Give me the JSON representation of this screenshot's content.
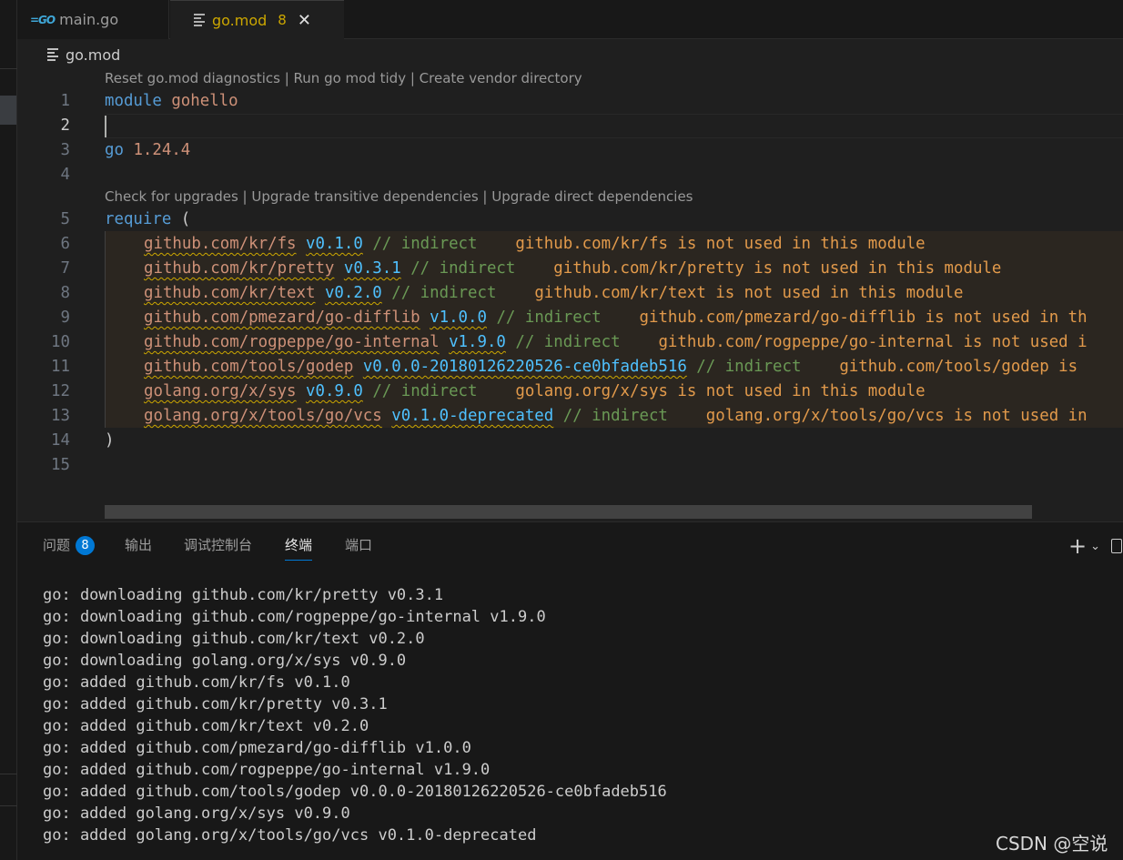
{
  "tabs": [
    {
      "file": "main.go",
      "icon": "go-file-icon"
    },
    {
      "file": "go.mod",
      "count": "8",
      "close": "✕",
      "icon": "lines-icon"
    }
  ],
  "breadcrumb": {
    "file": "go.mod"
  },
  "codelens": {
    "top": "Reset go.mod diagnostics | Run go mod tidy | Create vendor directory",
    "require": "Check for upgrades | Upgrade transitive dependencies | Upgrade direct dependencies"
  },
  "editor": {
    "line_numbers": [
      "1",
      "2",
      "3",
      "4",
      "5",
      "6",
      "7",
      "8",
      "9",
      "10",
      "11",
      "12",
      "13",
      "14",
      "15"
    ],
    "current_line": "2",
    "module_kw": "module",
    "module_name": "gohello",
    "go_kw": "go",
    "go_version": "1.24.4",
    "require_kw": "require",
    "open_paren": "(",
    "close_paren": ")",
    "requires": [
      {
        "path": "github.com/kr/fs",
        "version": "v0.1.0",
        "comment": "// indirect",
        "diag": "github.com/kr/fs is not used in this module"
      },
      {
        "path": "github.com/kr/pretty",
        "version": "v0.3.1",
        "comment": "// indirect",
        "diag": "github.com/kr/pretty is not used in this module"
      },
      {
        "path": "github.com/kr/text",
        "version": "v0.2.0",
        "comment": "// indirect",
        "diag": "github.com/kr/text is not used in this module"
      },
      {
        "path": "github.com/pmezard/go-difflib",
        "version": "v1.0.0",
        "comment": "// indirect",
        "diag": "github.com/pmezard/go-difflib is not used in th"
      },
      {
        "path": "github.com/rogpeppe/go-internal",
        "version": "v1.9.0",
        "comment": "// indirect",
        "diag": "github.com/rogpeppe/go-internal is not used i"
      },
      {
        "path": "github.com/tools/godep",
        "version": "v0.0.0-20180126220526-ce0bfadeb516",
        "comment": "// indirect",
        "diag": "github.com/tools/godep is"
      },
      {
        "path": "golang.org/x/sys",
        "version": "v0.9.0",
        "comment": "// indirect",
        "diag": "golang.org/x/sys is not used in this module"
      },
      {
        "path": "golang.org/x/tools/go/vcs",
        "version": "v0.1.0-deprecated",
        "comment": "// indirect",
        "diag": "golang.org/x/tools/go/vcs is not used in"
      }
    ]
  },
  "panel": {
    "tabs": [
      {
        "label": "问题",
        "badge": "8"
      },
      {
        "label": "输出"
      },
      {
        "label": "调试控制台"
      },
      {
        "label": "终端",
        "active": true
      },
      {
        "label": "端口"
      }
    ],
    "add_icon": "+",
    "chevron": "⌄"
  },
  "terminal": [
    "go: downloading github.com/kr/pretty v0.3.1",
    "go: downloading github.com/rogpeppe/go-internal v1.9.0",
    "go: downloading github.com/kr/text v0.2.0",
    "go: downloading golang.org/x/sys v0.9.0",
    "go: added github.com/kr/fs v0.1.0",
    "go: added github.com/kr/pretty v0.3.1",
    "go: added github.com/kr/text v0.2.0",
    "go: added github.com/pmezard/go-difflib v1.0.0",
    "go: added github.com/rogpeppe/go-internal v1.9.0",
    "go: added github.com/tools/godep v0.0.0-20180126220526-ce0bfadeb516",
    "go: added golang.org/x/sys v0.9.0",
    "go: added golang.org/x/tools/go/vcs v0.1.0-deprecated"
  ],
  "watermark": "CSDN @空说",
  "colors": {
    "accent": "#0078d4",
    "warning": "#cca700",
    "diag": "#e29a4b"
  }
}
